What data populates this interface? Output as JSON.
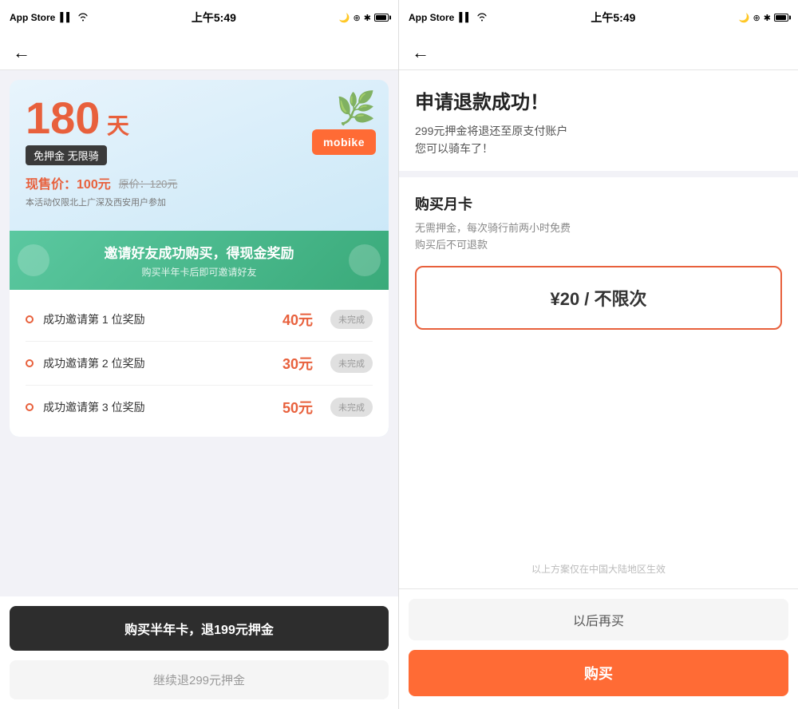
{
  "left": {
    "status": {
      "carrier": "App Store",
      "signal": "▌▌▌",
      "wifi": "WiFi",
      "time": "上午5:49",
      "battery_icons": "icons"
    },
    "nav": {
      "back": "←"
    },
    "promo": {
      "days": "180",
      "days_unit": "天",
      "badge": "免押金 无限骑",
      "current_price_label": "现售价：",
      "current_price": "100元",
      "original_price": "原价：120元",
      "restriction": "本活动仅限北上广深及西安用户参加"
    },
    "mobike": {
      "logo": "mobike"
    },
    "invite": {
      "main": "邀请好友成功购买，得现金奖励",
      "sub": "购买半年卡后即可邀请好友"
    },
    "rewards": [
      {
        "label": "成功邀请第 1 位奖励",
        "amount": "40元",
        "status": "未完成"
      },
      {
        "label": "成功邀请第 2 位奖励",
        "amount": "30元",
        "status": "未完成"
      },
      {
        "label": "成功邀请第 3 位奖励",
        "amount": "50元",
        "status": "未完成"
      }
    ],
    "buttons": {
      "primary": "购买半年卡，退199元押金",
      "secondary": "继续退299元押金"
    }
  },
  "right": {
    "status": {
      "carrier": "App Store",
      "signal": "▌▌▌",
      "wifi": "WiFi",
      "time": "上午5:49"
    },
    "nav": {
      "back": "←"
    },
    "success": {
      "title": "申请退款成功！",
      "desc_line1": "299元押金将退还至原支付账户",
      "desc_line2": "您可以骑车了！"
    },
    "monthly": {
      "title": "购买月卡",
      "desc": "无需押金，每次骑行前两小时免费\n购买后不可退款",
      "plan": {
        "price": "¥20 / 不限次"
      }
    },
    "notice": "以上方案仅在中国大陆地区生效",
    "buttons": {
      "later": "以后再买",
      "buy": "购买"
    }
  }
}
